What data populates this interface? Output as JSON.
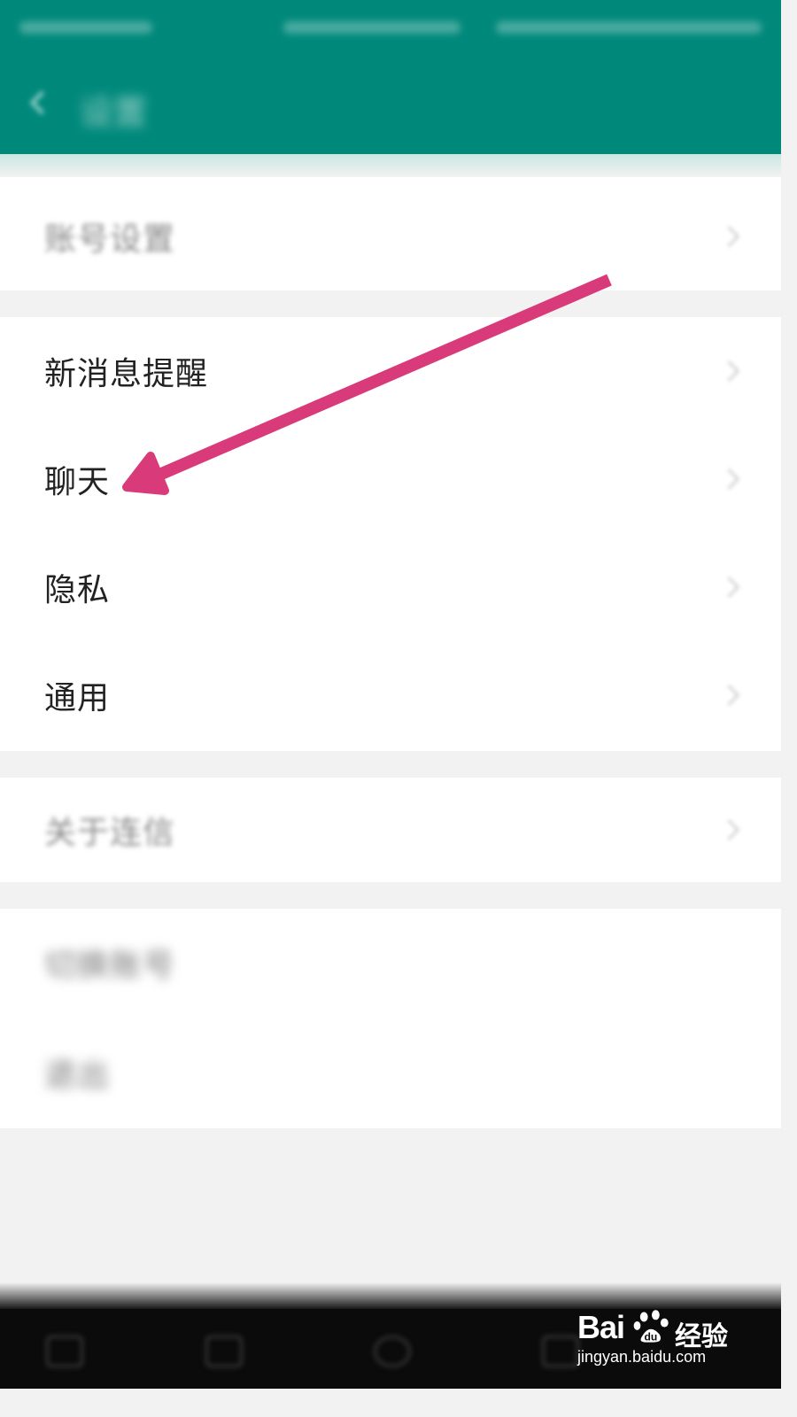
{
  "app_bar": {
    "title": "设置"
  },
  "settings": {
    "account": "账号设置",
    "group2": [
      "新消息提醒",
      "聊天",
      "隐私",
      "通用"
    ],
    "about": "关于连信",
    "group4": [
      "切换账号",
      "退出"
    ]
  },
  "annotation": {
    "color": "#d93a7a",
    "target": "聊天"
  },
  "watermark": {
    "brand": "Bai",
    "suffix": "经验",
    "url": "jingyan.baidu.com"
  },
  "colors": {
    "primary": "#00897b",
    "background": "#f2f2f2"
  }
}
